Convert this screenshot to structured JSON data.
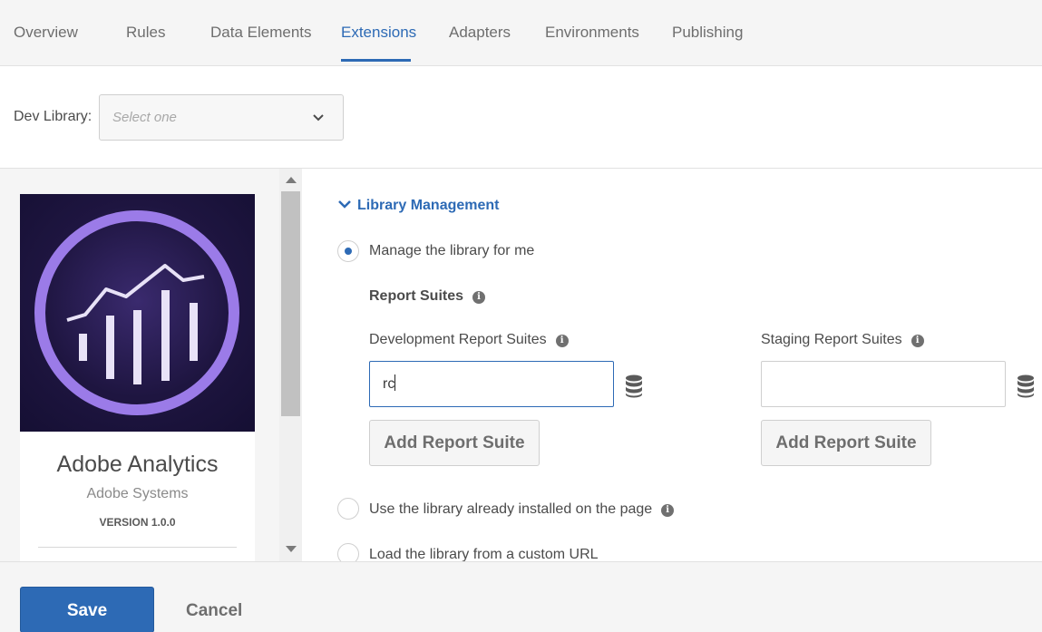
{
  "nav": {
    "tabs": [
      {
        "label": "Overview"
      },
      {
        "label": "Rules"
      },
      {
        "label": "Data Elements"
      },
      {
        "label": "Extensions"
      },
      {
        "label": "Adapters"
      },
      {
        "label": "Environments"
      },
      {
        "label": "Publishing"
      }
    ],
    "active_tab": "Extensions"
  },
  "dev_library": {
    "label": "Dev Library:",
    "placeholder": "Select one"
  },
  "extension_card": {
    "title": "Adobe Analytics",
    "vendor": "Adobe Systems",
    "version": "VERSION 1.0.0"
  },
  "library_management": {
    "title": "Library Management",
    "options": [
      {
        "label": "Manage the library for me",
        "selected": true
      },
      {
        "label": "Use the library already installed on the page",
        "selected": false
      },
      {
        "label": "Load the library from a custom URL",
        "selected": false
      }
    ],
    "report_suites_heading": "Report Suites",
    "development": {
      "label": "Development Report Suites",
      "value": "rc",
      "add_button": "Add Report Suite"
    },
    "staging": {
      "label": "Staging Report Suites",
      "value": "",
      "add_button": "Add Report Suite"
    }
  },
  "footer": {
    "save_label": "Save",
    "cancel_label": "Cancel"
  },
  "colors": {
    "accent": "#2d6ab5",
    "logo_ring": "#9b7be8"
  },
  "icons": [
    "chevron-down-icon",
    "info-icon",
    "database-icon",
    "scroll-up-arrow-icon",
    "scroll-down-arrow-icon"
  ]
}
